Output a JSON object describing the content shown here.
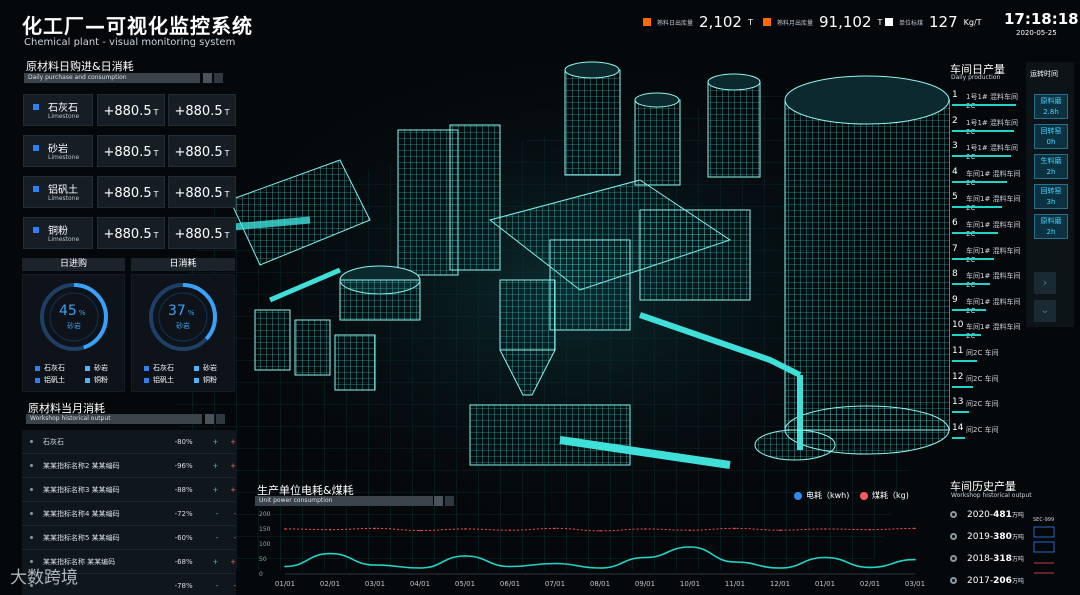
{
  "header": {
    "title": "化工厂—可视化监控系统",
    "subtitle": "Chemical plant - visual monitoring system",
    "stats": [
      {
        "label": "熟料日出库量",
        "value": "2,102",
        "unit": "T",
        "color": "#ff6a00"
      },
      {
        "label": "熟料月出库量",
        "value": "91,102",
        "unit": "T",
        "color": "#ff6a00"
      },
      {
        "label": "单位标煤",
        "value": "127",
        "unit": "Kg/T",
        "color": "#ffffff"
      }
    ],
    "time": "17:18:18",
    "date": "2020-05-25"
  },
  "raw_daily": {
    "title": "原材料日购进&日消耗",
    "subtitle": "Daily purchase and consumption",
    "items": [
      {
        "name": "石灰石",
        "en": "Limestone",
        "in_value": "+880.5",
        "out_value": "+880.5",
        "unit": "T"
      },
      {
        "name": "砂岩",
        "en": "Limestone",
        "in_value": "+880.5",
        "out_value": "+880.5",
        "unit": "T"
      },
      {
        "name": "铝矾土",
        "en": "Limestone",
        "in_value": "+880.5",
        "out_value": "+880.5",
        "unit": "T"
      },
      {
        "name": "铜粉",
        "en": "Limestone",
        "in_value": "+880.5",
        "out_value": "+880.5",
        "unit": "T"
      }
    ]
  },
  "donuts": [
    {
      "title": "日进购",
      "percent": 45,
      "pct_sign": "%",
      "label": "砂岩",
      "legend": [
        "石灰石",
        "砂岩",
        "铝矾土",
        "铜粉"
      ]
    },
    {
      "title": "日消耗",
      "percent": 37,
      "pct_sign": "%",
      "label": "砂岩",
      "legend": [
        "石灰石",
        "砂岩",
        "铝矾土",
        "铜粉"
      ]
    }
  ],
  "monthly": {
    "title": "原材料当月消耗",
    "subtitle": "Workshop historical output",
    "rows": [
      {
        "name": "石灰石",
        "pct": "-80%",
        "a": "+",
        "b": "+"
      },
      {
        "name": "某某指标名称2 某某编码",
        "pct": "-96%",
        "a": "+",
        "b": "+"
      },
      {
        "name": "某某指标名称3 某某编码",
        "pct": "-88%",
        "a": "+",
        "b": "+"
      },
      {
        "name": "某某指标名称4 某某编码",
        "pct": "-72%",
        "a": "-",
        "b": "-"
      },
      {
        "name": "某某指标名称5 某某编码",
        "pct": "-60%",
        "a": "-",
        "b": "-"
      },
      {
        "name": "某某指标名称 某某编码",
        "pct": "-68%",
        "a": "+",
        "b": "+"
      },
      {
        "name": "",
        "pct": "-78%",
        "a": "-",
        "b": "-"
      }
    ]
  },
  "watermark": "大数跨境",
  "production": {
    "title": "车间日产量",
    "subtitle": "Daily production",
    "rows": [
      {
        "n": "1",
        "t": "1号1# 混料车间2C",
        "fill": 0.92
      },
      {
        "n": "2",
        "t": "1号1# 混料车间2C",
        "fill": 0.88
      },
      {
        "n": "3",
        "t": "1号1# 混料车间2C",
        "fill": 0.84
      },
      {
        "n": "4",
        "t": "车间1# 混料车间2C",
        "fill": 0.78
      },
      {
        "n": "5",
        "t": "车间1# 混料车间2C",
        "fill": 0.72
      },
      {
        "n": "6",
        "t": "车间1# 混料车间2C",
        "fill": 0.66
      },
      {
        "n": "7",
        "t": "车间1# 混料车间2C",
        "fill": 0.6
      },
      {
        "n": "8",
        "t": "车间1# 混料车间2C",
        "fill": 0.54
      },
      {
        "n": "9",
        "t": "车间1# 混料车间2C",
        "fill": 0.48
      },
      {
        "n": "10",
        "t": "车间1# 混料车间2C",
        "fill": 0.42
      },
      {
        "n": "11",
        "t": "间2C 车间",
        "fill": 0.36
      },
      {
        "n": "12",
        "t": "间2C 车间",
        "fill": 0.3
      },
      {
        "n": "13",
        "t": "间2C 车间",
        "fill": 0.24
      },
      {
        "n": "14",
        "t": "间2C 车间",
        "fill": 0.18
      }
    ]
  },
  "shifts": {
    "title": "运转时间",
    "items": [
      {
        "label": "原料磨",
        "value": "2.8h"
      },
      {
        "label": "回转窑",
        "value": "0h"
      },
      {
        "label": "生料磨",
        "value": "2h"
      },
      {
        "label": "回转窑",
        "value": "3h"
      },
      {
        "label": "原料磨",
        "value": "2h"
      }
    ]
  },
  "history": {
    "title": "车间历史产量",
    "subtitle": "Workshop historical output",
    "rows": [
      {
        "year": "2020",
        "value": "481",
        "unit": "万吨"
      },
      {
        "year": "2019",
        "value": "380",
        "unit": "万吨"
      },
      {
        "year": "2018",
        "value": "318",
        "unit": "万吨"
      },
      {
        "year": "2017",
        "value": "206",
        "unit": "万吨"
      }
    ],
    "mini_label": "SEC-999"
  },
  "chart_data": {
    "type": "line",
    "title": "生产单位电耗&煤耗",
    "subtitle": "Unit power consumption",
    "x": [
      "01/01",
      "02/01",
      "03/01",
      "04/01",
      "05/01",
      "06/01",
      "07/01",
      "08/01",
      "09/01",
      "10/01",
      "11/01",
      "12/01",
      "01/01",
      "02/01",
      "03/01"
    ],
    "yticks": [
      "0",
      "50",
      "100",
      "150",
      "200"
    ],
    "ylim": [
      0,
      200
    ],
    "series": [
      {
        "name": "电耗（kwh)",
        "color": "#2f8cf5",
        "line_color": "#20d6c8",
        "values": [
          25,
          68,
          30,
          20,
          60,
          25,
          35,
          20,
          55,
          90,
          40,
          20,
          55,
          22,
          48
        ]
      },
      {
        "name": "煤耗（kg)",
        "color": "#ff5a5a",
        "line_color": "#ff4a4a",
        "values": [
          150,
          148,
          152,
          145,
          150,
          146,
          152,
          144,
          150,
          146,
          152,
          146,
          150,
          148,
          152
        ]
      }
    ],
    "legend": "top-right"
  },
  "colors": {
    "accent": "#20d6c8",
    "blue": "#2f7ff5",
    "bg": "#05080b"
  }
}
